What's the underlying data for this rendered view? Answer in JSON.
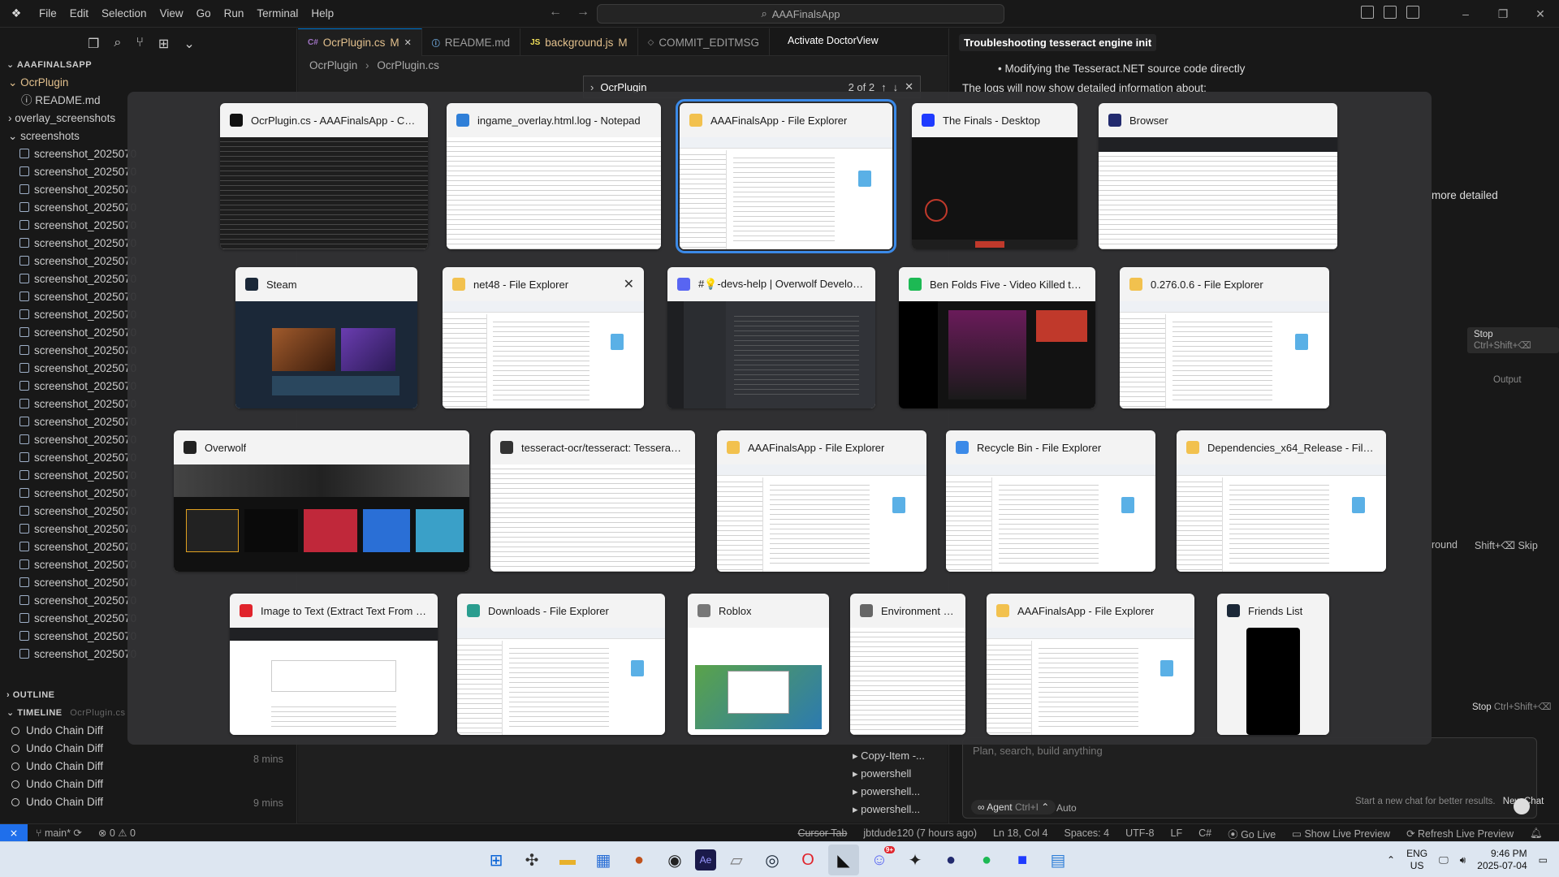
{
  "titlebar": {
    "menu": [
      "File",
      "Edit",
      "Selection",
      "View",
      "Go",
      "Run",
      "Terminal",
      "Help"
    ],
    "search": "AAAFinalsApp"
  },
  "sidebar": {
    "root": "AAAFINALSAPP",
    "items": [
      {
        "label": "OcrPlugin",
        "kind": "folder-modified"
      },
      {
        "label": "README.md",
        "kind": "file"
      },
      {
        "label": "overlay_screenshots",
        "kind": "folder"
      },
      {
        "label": "screenshots",
        "kind": "folder"
      }
    ],
    "screenshot_label": "screenshot_2025070",
    "screenshot_count": 29,
    "outline": "OUTLINE",
    "timeline": "TIMELINE",
    "timeline_file": "OcrPlugin.cs",
    "timeline_items": [
      "Undo Chain Diff",
      "Undo Chain Diff",
      "Undo Chain Diff",
      "Undo Chain Diff",
      "Undo Chain Diff"
    ],
    "timeline_times": [
      "8 mins",
      "9 mins"
    ]
  },
  "tabs": [
    {
      "label": "OcrPlugin.cs",
      "mod": "M",
      "active": true
    },
    {
      "label": "README.md",
      "mod": "",
      "active": false
    },
    {
      "label": "background.js",
      "mod": "M",
      "active": false
    },
    {
      "label": "COMMIT_EDITMSG",
      "mod": "",
      "active": false
    }
  ],
  "editor": {
    "activate": "Activate DoctorView",
    "breadcrumb": [
      "OcrPlugin",
      "OcrPlugin.cs"
    ],
    "find_value": "OcrPlugin",
    "find_count": "2 of 2"
  },
  "chat": {
    "title": "Troubleshooting tesseract engine init",
    "bullet": "Modifying the Tesseract.NET source code directly",
    "logs": "The logs will now show detailed information about:",
    "more": "more detailed",
    "stop": "Stop",
    "stop_shortcut": "Ctrl+Shift+⌫",
    "output": "Output",
    "round": "round",
    "skip": "Shift+⌫ Skip",
    "placeholder": "Plan, search, build anything",
    "agent": "Agent",
    "agent_shortcut": "Ctrl+I",
    "auto": "Auto",
    "hint": "Start a new chat for better results.",
    "new_chat": "New Chat",
    "terminals": [
      "Copy-Item -...",
      "powershell",
      "powershell...",
      "powershell..."
    ]
  },
  "statusbar": {
    "branch": "main*",
    "problems": "0 ⚠ 0",
    "cursor_tab": "Cursor Tab",
    "blame": "jbtdude120 (7 hours ago)",
    "position": "Ln 18, Col 4",
    "spaces": "Spaces: 4",
    "encoding": "UTF-8",
    "eol": "LF",
    "lang": "C#",
    "golive": "Go Live",
    "live_preview": "Show Live Preview",
    "refresh": "Refresh Live Preview"
  },
  "taskbar": {
    "lang": "ENG",
    "region": "US",
    "time": "9:46 PM",
    "date": "2025-07-04",
    "badge": "9+"
  },
  "alttab": {
    "windows": [
      {
        "title": "OcrPlugin.cs - AAAFinalsApp - Cursor",
        "icon": "cursor-icon",
        "icon_color": "#111111",
        "thumb": "dark-code"
      },
      {
        "title": "ingame_overlay.html.log - Notepad",
        "icon": "notepad-icon",
        "icon_color": "#2f7fd8",
        "thumb": "light-text"
      },
      {
        "title": "AAAFinalsApp - File Explorer",
        "icon": "folder-icon",
        "icon_color": "#f2c14e",
        "thumb": "explorer",
        "selected": true
      },
      {
        "title": "The Finals - Desktop",
        "icon": "blue-square-icon",
        "icon_color": "#1f3bff",
        "thumb": "dark-app"
      },
      {
        "title": "Browser",
        "icon": "browser-icon",
        "icon_color": "#222a6e",
        "thumb": "browser"
      },
      {
        "title": "Steam",
        "icon": "steam-icon",
        "icon_color": "#1b2838",
        "thumb": "steam"
      },
      {
        "title": "net48 - File Explorer",
        "icon": "folder-icon",
        "icon_color": "#f2c14e",
        "thumb": "explorer",
        "close": true
      },
      {
        "title": "#💡-devs-help | Overwolf Developers...",
        "icon": "discord-icon",
        "icon_color": "#5865f2",
        "thumb": "discord"
      },
      {
        "title": "Ben Folds Five - Video Killed the R...",
        "icon": "spotify-icon",
        "icon_color": "#1db954",
        "thumb": "spotify"
      },
      {
        "title": "0.276.0.6 - File Explorer",
        "icon": "folder-icon",
        "icon_color": "#f2c14e",
        "thumb": "explorer"
      },
      {
        "title": "Overwolf",
        "icon": "overwolf-icon",
        "icon_color": "#222222",
        "thumb": "overwolf"
      },
      {
        "title": "tesseract-ocr/tesseract: Tesseract O...",
        "icon": "github-icon",
        "icon_color": "#333333",
        "thumb": "light-text"
      },
      {
        "title": "AAAFinalsApp - File Explorer",
        "icon": "folder-icon",
        "icon_color": "#f2c14e",
        "thumb": "explorer"
      },
      {
        "title": "Recycle Bin - File Explorer",
        "icon": "recycle-bin-icon",
        "icon_color": "#3b8ae8",
        "thumb": "explorer"
      },
      {
        "title": "Dependencies_x64_Release - File Expl...",
        "icon": "folder-icon",
        "icon_color": "#f2c14e",
        "thumb": "explorer"
      },
      {
        "title": "Image to Text (Extract Text From Ima...",
        "icon": "opera-icon",
        "icon_color": "#e0242c",
        "thumb": "webpage"
      },
      {
        "title": "Downloads - File Explorer",
        "icon": "download-icon",
        "icon_color": "#2a9d8f",
        "thumb": "explorer"
      },
      {
        "title": "Roblox",
        "icon": "roblox-icon",
        "icon_color": "#777777",
        "thumb": "roblox"
      },
      {
        "title": "Environment Va...",
        "icon": "settings-window-icon",
        "icon_color": "#666666",
        "thumb": "light-text"
      },
      {
        "title": "AAAFinalsApp - File Explorer",
        "icon": "folder-icon",
        "icon_color": "#f2c14e",
        "thumb": "explorer"
      },
      {
        "title": "Friends List",
        "icon": "steam-icon",
        "icon_color": "#1b2838",
        "thumb": "black"
      }
    ]
  }
}
